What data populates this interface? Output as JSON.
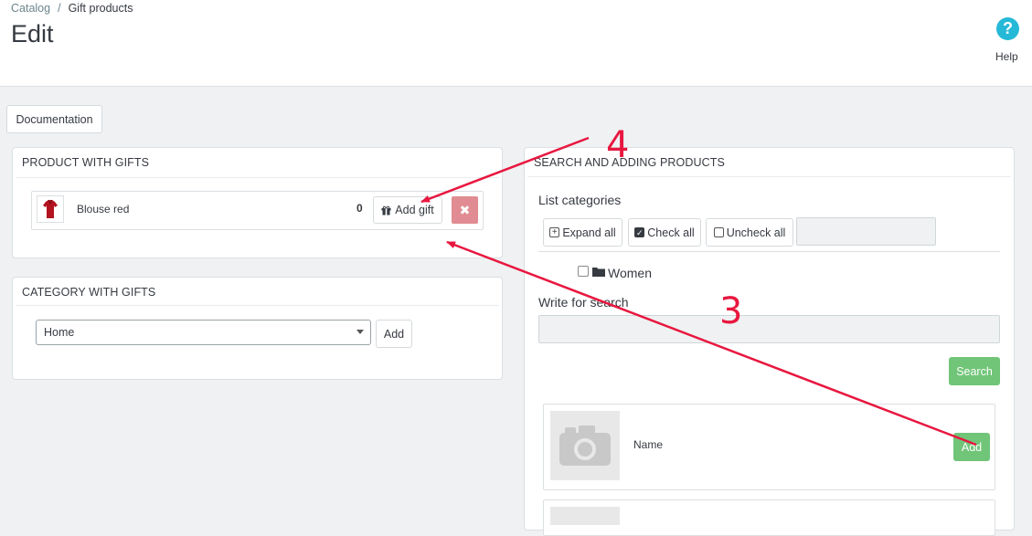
{
  "breadcrumb": {
    "parent": "Catalog",
    "separator": "/",
    "current": "Gift products"
  },
  "page": {
    "title": "Edit"
  },
  "help": {
    "glyph": "?",
    "label": "Help"
  },
  "toolbar": {
    "documentation_label": "Documentation"
  },
  "product_panel": {
    "heading": "PRODUCT WITH GIFTS",
    "product": {
      "name": "Blouse red",
      "count": "0",
      "add_gift_label": "Add gift",
      "remove_glyph": "✖"
    }
  },
  "category_panel": {
    "heading": "CATEGORY WITH GIFTS",
    "selected": "Home",
    "add_label": "Add"
  },
  "search_panel": {
    "heading": "SEARCH AND ADDING PRODUCTS",
    "list_categories_label": "List categories",
    "expand_all_label": "Expand all",
    "check_all_label": "Check all",
    "uncheck_all_label": "Uncheck all",
    "category_filter_value": "",
    "tree": [
      {
        "label": "Women",
        "checked": false
      }
    ],
    "write_for_search_label": "Write for search",
    "search_value": "",
    "search_button_label": "Search",
    "results": [
      {
        "name": "Name",
        "add_label": "Add"
      }
    ]
  },
  "annotations": {
    "label_4": "4",
    "label_3": "3"
  },
  "colors": {
    "accent": "#25b9d7",
    "success": "#70c578",
    "danger": "#e08c92",
    "annotation": "#e8173f",
    "background": "#eff1f2"
  }
}
